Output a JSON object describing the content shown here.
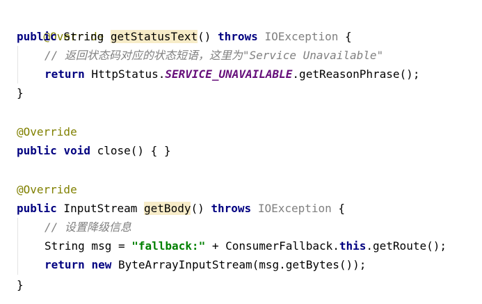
{
  "lines": [
    {
      "tokens": [
        "@Override"
      ]
    },
    {
      "tokens": [
        "public",
        " String ",
        "getStatusText",
        "() ",
        "throws",
        " ",
        "IOException",
        " {"
      ]
    },
    {
      "tokens": [
        "// 返回状态码对应的状态短语，这里为\"Service Unavailable\""
      ]
    },
    {
      "tokens": [
        "return",
        " HttpStatus.",
        "SERVICE_UNAVAILABLE",
        ".getReasonPhrase();"
      ]
    },
    {
      "tokens": [
        "}"
      ]
    },
    {
      "tokens": [
        "@Override"
      ]
    },
    {
      "tokens": [
        "public",
        " ",
        "void",
        " close() { }"
      ]
    },
    {
      "tokens": [
        "@Override"
      ]
    },
    {
      "tokens": [
        "public",
        " InputStream ",
        "getBody",
        "() ",
        "throws",
        " ",
        "IOException",
        " {"
      ]
    },
    {
      "tokens": [
        "// 设置降级信息"
      ]
    },
    {
      "tokens": [
        "String msg = ",
        "\"fallback:\"",
        " + ConsumerFallback.",
        "this",
        ".getRoute();"
      ]
    },
    {
      "tokens": [
        "return",
        " ",
        "new",
        " ByteArrayInputStream(msg.getBytes());"
      ]
    },
    {
      "tokens": [
        "}"
      ]
    }
  ]
}
